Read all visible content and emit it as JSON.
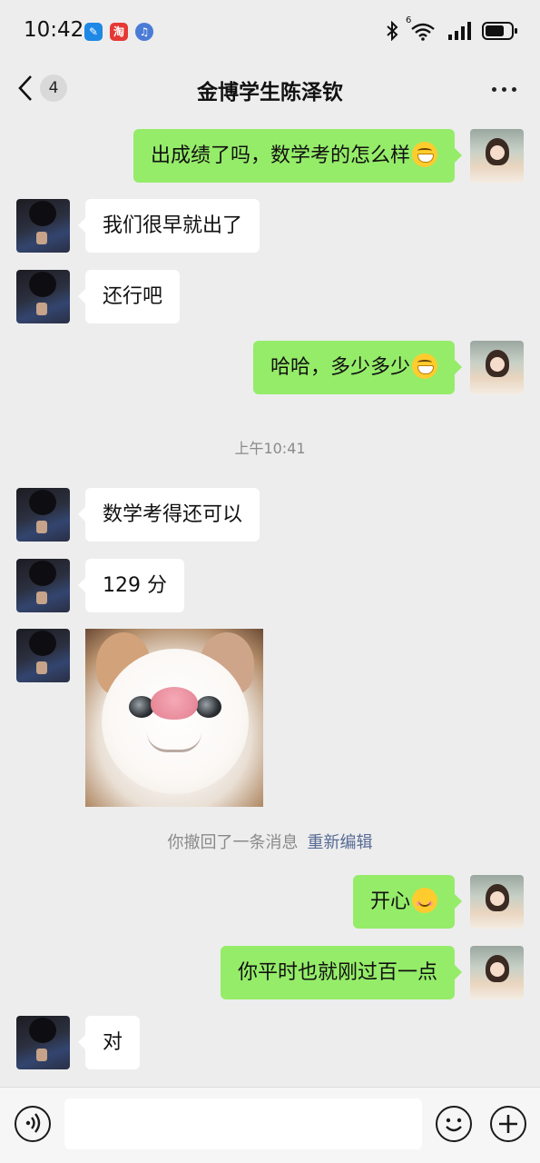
{
  "status_bar": {
    "time": "10:42",
    "app_badges": [
      {
        "name": "feishu-icon",
        "color": "#1e88e5",
        "glyph": "✎"
      },
      {
        "name": "taobao-icon",
        "color": "#e53935",
        "glyph": "淘"
      },
      {
        "name": "music-icon",
        "color": "#4a7bd6",
        "glyph": "♫"
      }
    ],
    "network": "6",
    "battery_level": 0.7
  },
  "nav": {
    "unread_count": "4",
    "title": "金博学生陈泽钦"
  },
  "messages": [
    {
      "side": "right",
      "type": "text",
      "text": "出成绩了吗，数学考的怎么样",
      "emoji": "grin"
    },
    {
      "side": "left",
      "type": "text",
      "text": "我们很早就出了"
    },
    {
      "side": "left",
      "type": "text",
      "text": "还行吧"
    },
    {
      "side": "right",
      "type": "text",
      "text": "哈哈，多少多少",
      "emoji": "grin"
    },
    {
      "type": "timestamp",
      "text": "上午10:41"
    },
    {
      "side": "left",
      "type": "text",
      "text": "数学考得还可以"
    },
    {
      "side": "left",
      "type": "text",
      "text": "129 分"
    },
    {
      "side": "left",
      "type": "sticker",
      "description": "cat-sticker"
    },
    {
      "type": "recall",
      "text": "你撤回了一条消息",
      "action": "重新编辑"
    },
    {
      "side": "right",
      "type": "text",
      "text": "开心",
      "emoji": "smile"
    },
    {
      "side": "right",
      "type": "text",
      "text": "你平时也就刚过百一点"
    },
    {
      "side": "left",
      "type": "text",
      "text": "对"
    }
  ],
  "input_bar": {
    "value": "",
    "icons": [
      "voice-icon",
      "emoji-icon",
      "plus-icon"
    ]
  },
  "colors": {
    "background": "#ededed",
    "my_bubble": "#95ec69",
    "their_bubble": "#ffffff",
    "link": "#576b95"
  }
}
